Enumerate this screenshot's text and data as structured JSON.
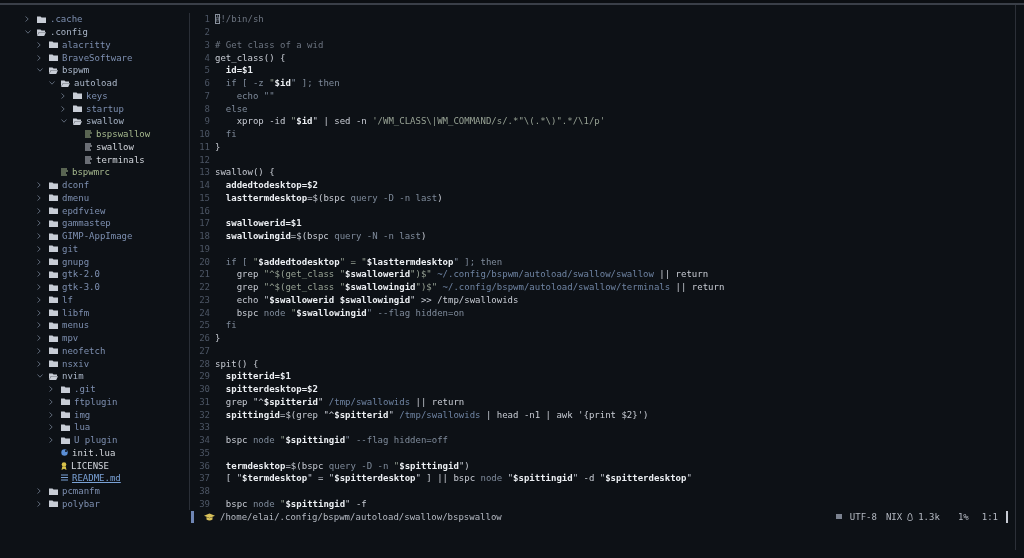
{
  "file_tree": [
    {
      "name": ".cache",
      "kind": "folder",
      "expanded": false
    },
    {
      "name": ".config",
      "kind": "folder",
      "expanded": true,
      "children": [
        {
          "name": "alacritty",
          "kind": "folder",
          "expanded": false
        },
        {
          "name": "BraveSoftware",
          "kind": "folder",
          "expanded": false
        },
        {
          "name": "bspwm",
          "kind": "folder",
          "expanded": true,
          "children": [
            {
              "name": "autoload",
              "kind": "folder",
              "expanded": true,
              "children": [
                {
                  "name": "keys",
                  "kind": "folder",
                  "expanded": false
                },
                {
                  "name": "startup",
                  "kind": "folder",
                  "expanded": false
                },
                {
                  "name": "swallow",
                  "kind": "folder",
                  "expanded": true,
                  "children": [
                    {
                      "name": "bspswallow",
                      "kind": "script"
                    },
                    {
                      "name": "swallow",
                      "kind": "text"
                    },
                    {
                      "name": "terminals",
                      "kind": "text"
                    }
                  ]
                }
              ]
            },
            {
              "name": "bspwmrc",
              "kind": "script"
            }
          ]
        },
        {
          "name": "dconf",
          "kind": "folder",
          "expanded": false
        },
        {
          "name": "dmenu",
          "kind": "folder",
          "expanded": false
        },
        {
          "name": "epdfview",
          "kind": "folder",
          "expanded": false
        },
        {
          "name": "gammastep",
          "kind": "folder",
          "expanded": false
        },
        {
          "name": "GIMP-AppImage",
          "kind": "folder",
          "expanded": false
        },
        {
          "name": "git",
          "kind": "folder",
          "expanded": false
        },
        {
          "name": "gnupg",
          "kind": "folder",
          "expanded": false
        },
        {
          "name": "gtk-2.0",
          "kind": "folder",
          "expanded": false
        },
        {
          "name": "gtk-3.0",
          "kind": "folder",
          "expanded": false
        },
        {
          "name": "lf",
          "kind": "folder",
          "expanded": false
        },
        {
          "name": "libfm",
          "kind": "folder",
          "expanded": false
        },
        {
          "name": "menus",
          "kind": "folder",
          "expanded": false
        },
        {
          "name": "mpv",
          "kind": "folder",
          "expanded": false
        },
        {
          "name": "neofetch",
          "kind": "folder",
          "expanded": false
        },
        {
          "name": "nsxiv",
          "kind": "folder",
          "expanded": false
        },
        {
          "name": "nvim",
          "kind": "folder",
          "expanded": true,
          "children": [
            {
              "name": ".git",
              "kind": "folder",
              "expanded": false
            },
            {
              "name": "ftplugin",
              "kind": "folder",
              "expanded": false
            },
            {
              "name": "img",
              "kind": "folder",
              "expanded": false
            },
            {
              "name": "lua",
              "kind": "folder",
              "expanded": false
            },
            {
              "name": "U plugin",
              "kind": "folder",
              "expanded": false
            },
            {
              "name": "init.lua",
              "kind": "lua"
            },
            {
              "name": "LICENSE",
              "kind": "license"
            },
            {
              "name": "README.md",
              "kind": "markdown"
            }
          ]
        },
        {
          "name": "pcmanfm",
          "kind": "folder",
          "expanded": false
        },
        {
          "name": "polybar",
          "kind": "folder",
          "expanded": false
        }
      ]
    }
  ],
  "editor": {
    "lines": [
      {
        "number": "1",
        "tokens": [
          {
            "text": "#",
            "kind": "cursor"
          },
          {
            "text": "!/bin/sh",
            "kind": "comment"
          }
        ]
      },
      {
        "number": "2"
      },
      {
        "number": "3",
        "tokens": [
          {
            "text": "# Get class of a wid",
            "kind": "comment"
          }
        ]
      },
      {
        "number": "4",
        "tokens": [
          {
            "text": "get_class() {",
            "kind": "plain"
          }
        ]
      },
      {
        "number": "5",
        "tokens": [
          {
            "text": "  id=$1",
            "kind": "var"
          }
        ]
      },
      {
        "number": "6",
        "tokens": [
          {
            "text": "  if [ -z ",
            "kind": "keyword"
          },
          {
            "text": "\"",
            "kind": "string"
          },
          {
            "text": "$id",
            "kind": "var"
          },
          {
            "text": "\" ]; then",
            "kind": "keyword"
          }
        ]
      },
      {
        "number": "7",
        "tokens": [
          {
            "text": "    echo \"\"",
            "kind": "keyword"
          }
        ]
      },
      {
        "number": "8",
        "tokens": [
          {
            "text": "  else",
            "kind": "keyword"
          }
        ]
      },
      {
        "number": "9",
        "tokens": [
          {
            "text": "    xprop -id ",
            "kind": "plain"
          },
          {
            "text": "\"",
            "kind": "string"
          },
          {
            "text": "$id",
            "kind": "var"
          },
          {
            "text": "\" | sed -n ",
            "kind": "plain"
          },
          {
            "text": "'/WM_CLASS\\|WM_COMMAND/s/.*\"\\(.*\\)\".*/\\1/p'",
            "kind": "string"
          }
        ]
      },
      {
        "number": "10",
        "tokens": [
          {
            "text": "  fi",
            "kind": "keyword"
          }
        ]
      },
      {
        "number": "11",
        "tokens": [
          {
            "text": "}",
            "kind": "plain"
          }
        ]
      },
      {
        "number": "12"
      },
      {
        "number": "13",
        "tokens": [
          {
            "text": "swallow() {",
            "kind": "plain"
          }
        ]
      },
      {
        "number": "14",
        "tokens": [
          {
            "text": "  addedtodesktop=$2",
            "kind": "var"
          }
        ]
      },
      {
        "number": "15",
        "tokens": [
          {
            "text": "  lasttermdesktop",
            "kind": "var"
          },
          {
            "text": "=$(bspc ",
            "kind": "plain"
          },
          {
            "text": "query -D -n last",
            "kind": "keyword"
          },
          {
            "text": ")",
            "kind": "plain"
          }
        ]
      },
      {
        "number": "16"
      },
      {
        "number": "17",
        "tokens": [
          {
            "text": "  swallowerid=$1",
            "kind": "var"
          }
        ]
      },
      {
        "number": "18",
        "tokens": [
          {
            "text": "  swallowingid",
            "kind": "var"
          },
          {
            "text": "=$(bspc ",
            "kind": "plain"
          },
          {
            "text": "query -N -n last",
            "kind": "keyword"
          },
          {
            "text": ")",
            "kind": "plain"
          }
        ]
      },
      {
        "number": "19"
      },
      {
        "number": "20",
        "tokens": [
          {
            "text": "  if [ ",
            "kind": "keyword"
          },
          {
            "text": "\"",
            "kind": "string"
          },
          {
            "text": "$addedtodesktop",
            "kind": "var"
          },
          {
            "text": "\" = \"",
            "kind": "string"
          },
          {
            "text": "$lasttermdesktop",
            "kind": "var"
          },
          {
            "text": "\" ]; then",
            "kind": "keyword"
          }
        ]
      },
      {
        "number": "21",
        "tokens": [
          {
            "text": "    grep ",
            "kind": "plain"
          },
          {
            "text": "\"^$(get_class \"",
            "kind": "string"
          },
          {
            "text": "$swallowerid",
            "kind": "var"
          },
          {
            "text": "\")$\" ",
            "kind": "string"
          },
          {
            "text": "~/.config/bspwm/autoload/swallow/swallow",
            "kind": "path"
          },
          {
            "text": " || return",
            "kind": "plain"
          }
        ]
      },
      {
        "number": "22",
        "tokens": [
          {
            "text": "    grep ",
            "kind": "plain"
          },
          {
            "text": "\"^$(get_class \"",
            "kind": "string"
          },
          {
            "text": "$swallowingid",
            "kind": "var"
          },
          {
            "text": "\")$\" ",
            "kind": "string"
          },
          {
            "text": "~/.config/bspwm/autoload/swallow/terminals",
            "kind": "path"
          },
          {
            "text": " || return",
            "kind": "plain"
          }
        ]
      },
      {
        "number": "23",
        "tokens": [
          {
            "text": "    echo \"",
            "kind": "plain"
          },
          {
            "text": "$swallowerid $swallowingid",
            "kind": "var"
          },
          {
            "text": "\" >> /tmp/swallowids",
            "kind": "plain"
          }
        ]
      },
      {
        "number": "24",
        "tokens": [
          {
            "text": "    bspc ",
            "kind": "plain"
          },
          {
            "text": "node ",
            "kind": "keyword"
          },
          {
            "text": "\"",
            "kind": "string"
          },
          {
            "text": "$swallowingid",
            "kind": "var"
          },
          {
            "text": "\" --flag hidden=on",
            "kind": "keyword"
          }
        ]
      },
      {
        "number": "25",
        "tokens": [
          {
            "text": "  fi",
            "kind": "keyword"
          }
        ]
      },
      {
        "number": "26",
        "tokens": [
          {
            "text": "}",
            "kind": "plain"
          }
        ]
      },
      {
        "number": "27"
      },
      {
        "number": "28",
        "tokens": [
          {
            "text": "spit() {",
            "kind": "plain"
          }
        ]
      },
      {
        "number": "29",
        "tokens": [
          {
            "text": "  spitterid=$1",
            "kind": "var"
          }
        ]
      },
      {
        "number": "30",
        "tokens": [
          {
            "text": "  spitterdesktop=$2",
            "kind": "var"
          }
        ]
      },
      {
        "number": "31",
        "tokens": [
          {
            "text": "  grep \"^",
            "kind": "plain"
          },
          {
            "text": "$spitterid",
            "kind": "var"
          },
          {
            "text": "\" ",
            "kind": "plain"
          },
          {
            "text": "/tmp/swallowids",
            "kind": "path"
          },
          {
            "text": " || return",
            "kind": "plain"
          }
        ]
      },
      {
        "number": "32",
        "tokens": [
          {
            "text": "  spittingid",
            "kind": "var"
          },
          {
            "text": "=$(grep \"^",
            "kind": "plain"
          },
          {
            "text": "$spitterid",
            "kind": "var"
          },
          {
            "text": "\" ",
            "kind": "plain"
          },
          {
            "text": "/tmp/swallowids",
            "kind": "path"
          },
          {
            "text": " | head -n1 | awk '{print $2}')",
            "kind": "plain"
          }
        ]
      },
      {
        "number": "33"
      },
      {
        "number": "34",
        "tokens": [
          {
            "text": "  bspc ",
            "kind": "plain"
          },
          {
            "text": "node ",
            "kind": "keyword"
          },
          {
            "text": "\"",
            "kind": "string"
          },
          {
            "text": "$spittingid",
            "kind": "var"
          },
          {
            "text": "\" --flag hidden=off",
            "kind": "keyword"
          }
        ]
      },
      {
        "number": "35"
      },
      {
        "number": "36",
        "tokens": [
          {
            "text": "  termdesktop",
            "kind": "var"
          },
          {
            "text": "=$(bspc ",
            "kind": "plain"
          },
          {
            "text": "query -D -n ",
            "kind": "keyword"
          },
          {
            "text": "\"",
            "kind": "string"
          },
          {
            "text": "$spittingid",
            "kind": "var"
          },
          {
            "text": "\")",
            "kind": "plain"
          }
        ]
      },
      {
        "number": "37",
        "tokens": [
          {
            "text": "  [ \"",
            "kind": "plain"
          },
          {
            "text": "$termdesktop",
            "kind": "var"
          },
          {
            "text": "\" = \"",
            "kind": "plain"
          },
          {
            "text": "$spitterdesktop",
            "kind": "var"
          },
          {
            "text": "\" ] || bspc ",
            "kind": "plain"
          },
          {
            "text": "node ",
            "kind": "keyword"
          },
          {
            "text": "\"",
            "kind": "plain"
          },
          {
            "text": "$spittingid",
            "kind": "var"
          },
          {
            "text": "\" -d \"",
            "kind": "plain"
          },
          {
            "text": "$spitterdesktop",
            "kind": "var"
          },
          {
            "text": "\"",
            "kind": "plain"
          }
        ]
      },
      {
        "number": "38"
      },
      {
        "number": "39",
        "tokens": [
          {
            "text": "  bspc ",
            "kind": "plain"
          },
          {
            "text": "node ",
            "kind": "keyword"
          },
          {
            "text": "\"",
            "kind": "string"
          },
          {
            "text": "$spittingid",
            "kind": "var"
          },
          {
            "text": "\" -f",
            "kind": "plain"
          }
        ]
      }
    ]
  },
  "status_bar": {
    "path": "/home/elai/.config/bspwm/autoload/swallow/bspswallow",
    "encoding": "UTF-8",
    "format": "NIX",
    "size": "1.3k",
    "percent": "1%",
    "position": "1:1"
  }
}
